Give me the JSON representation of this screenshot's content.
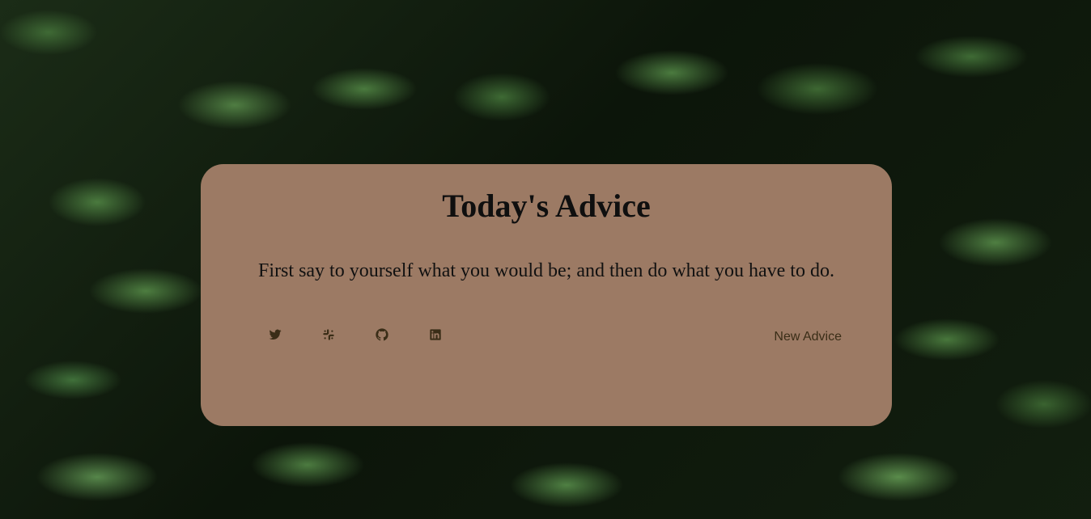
{
  "card": {
    "title": "Today's Advice",
    "advice": "First say to yourself what you would be; and then do what you have to do.",
    "new_advice_label": "New Advice"
  },
  "socials": [
    {
      "name": "twitter",
      "icon": "twitter-icon"
    },
    {
      "name": "slack",
      "icon": "slack-icon"
    },
    {
      "name": "github",
      "icon": "github-icon"
    },
    {
      "name": "linkedin",
      "icon": "linkedin-icon"
    }
  ],
  "colors": {
    "card_background": "#9c7a64",
    "icon_color": "#3a2d17",
    "text_color": "#0f0f0f"
  }
}
